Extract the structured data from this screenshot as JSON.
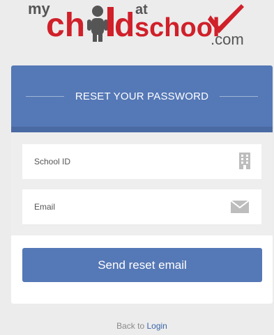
{
  "logo": {
    "prefix": "my",
    "word_left": "ch",
    "word_right": "d",
    "superscript": "at",
    "word_school": "school",
    "suffix": ".com",
    "red": "#d0202a",
    "grey": "#555555",
    "icons": [
      "child-figure-icon",
      "checkmark-icon"
    ]
  },
  "card": {
    "title": "RESET YOUR PASSWORD",
    "accent": "#5578b6"
  },
  "form": {
    "school_id_placeholder": "School ID",
    "email_placeholder": "Email",
    "school_id_icon": "building-icon",
    "email_icon": "envelope-icon"
  },
  "submit_label": "Send reset email",
  "footer": {
    "prefix": "Back to ",
    "link": "Login"
  }
}
